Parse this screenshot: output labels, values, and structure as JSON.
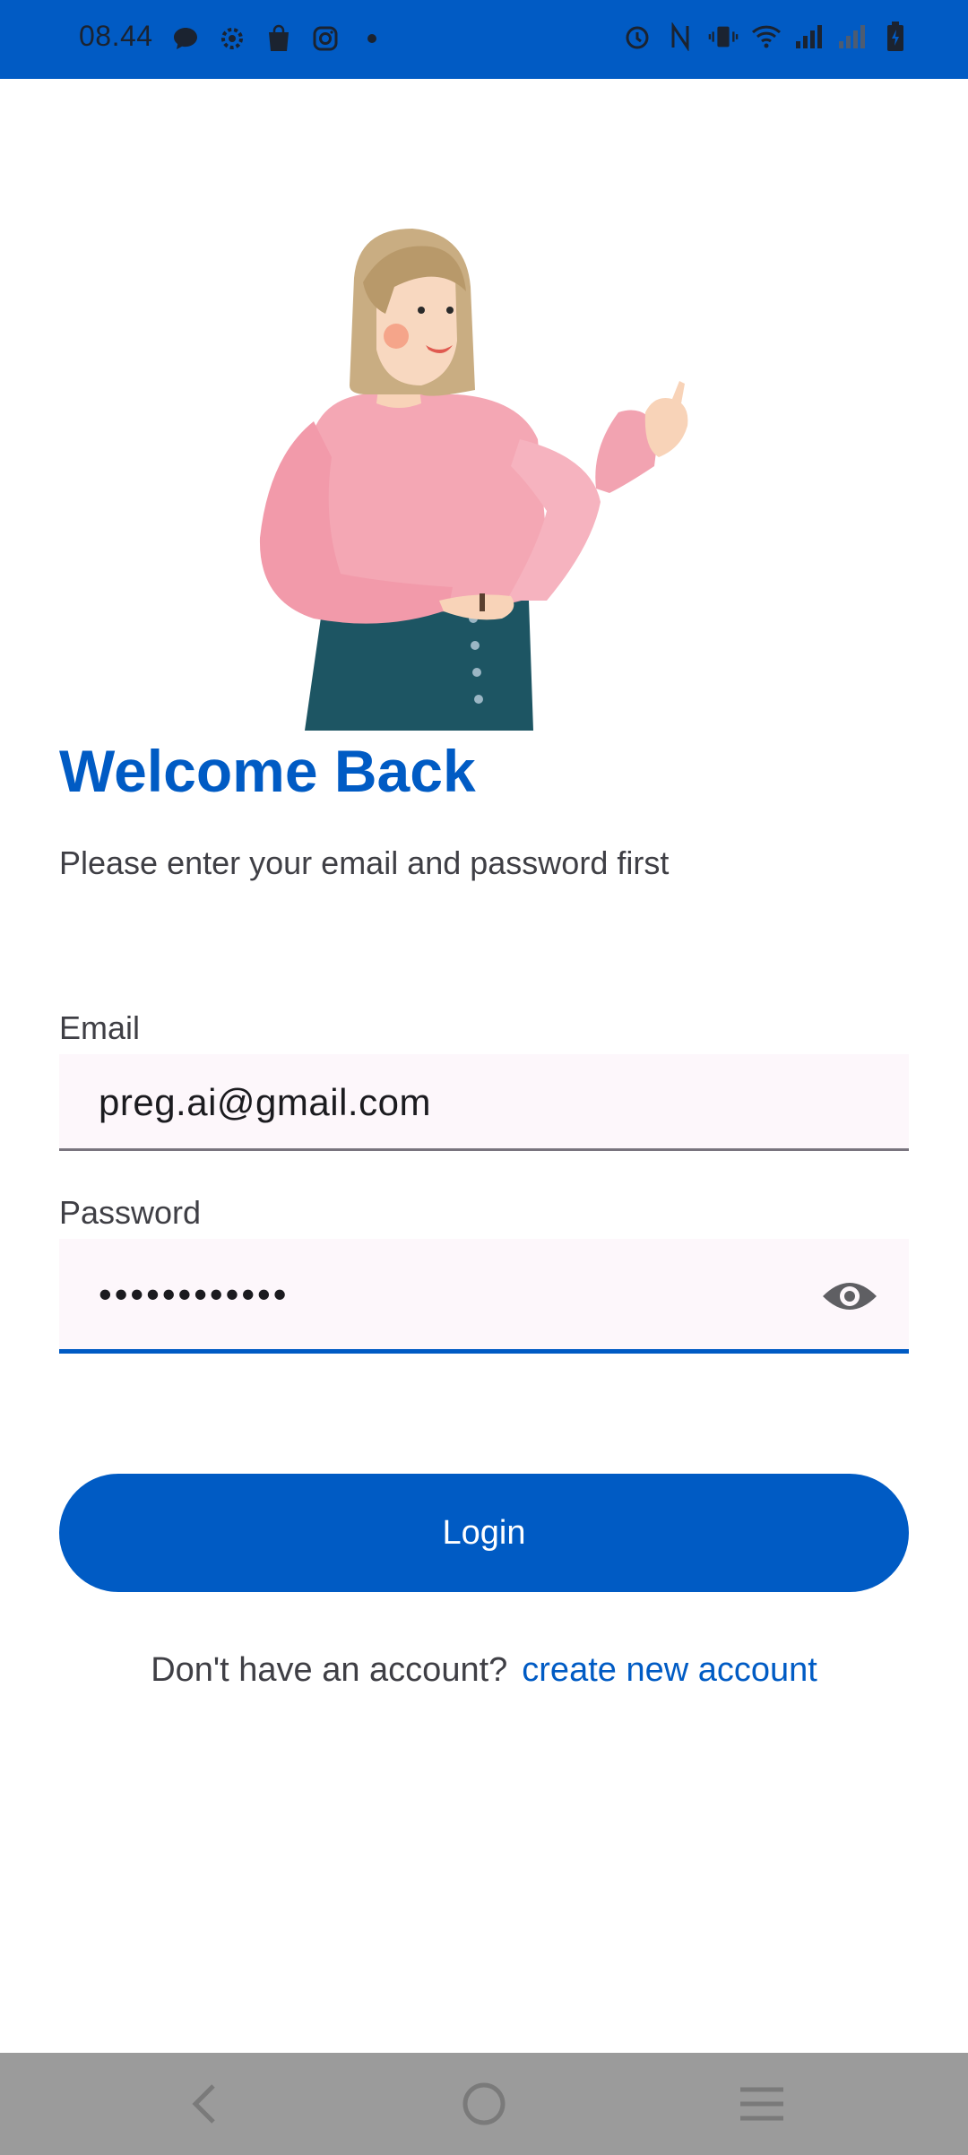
{
  "status_bar": {
    "time": "08.44",
    "icons": [
      "chat-icon",
      "settings-icon",
      "shopping-bag-icon",
      "instagram-icon",
      "dot-icon",
      "alarm-icon",
      "nfc-icon",
      "vibrate-icon",
      "wifi-icon",
      "signal-icon",
      "signal-weak-icon",
      "battery-charging-icon"
    ]
  },
  "login": {
    "title": "Welcome Back",
    "subtitle": "Please enter your email and password first",
    "email_label": "Email",
    "email_value": "preg.ai@gmail.com",
    "password_label": "Password",
    "password_value": "••••••••••••",
    "login_button": "Login",
    "signup_prompt": "Don't have an account?",
    "signup_link": "create new account"
  },
  "nav_bar": {
    "icons": [
      "back-icon",
      "home-icon",
      "menu-icon"
    ]
  },
  "colors": {
    "primary": "#005bc4",
    "status_bar": "#015bc4",
    "field_background": "#fdf7fb",
    "nav_bar": "#9b9b9b"
  }
}
